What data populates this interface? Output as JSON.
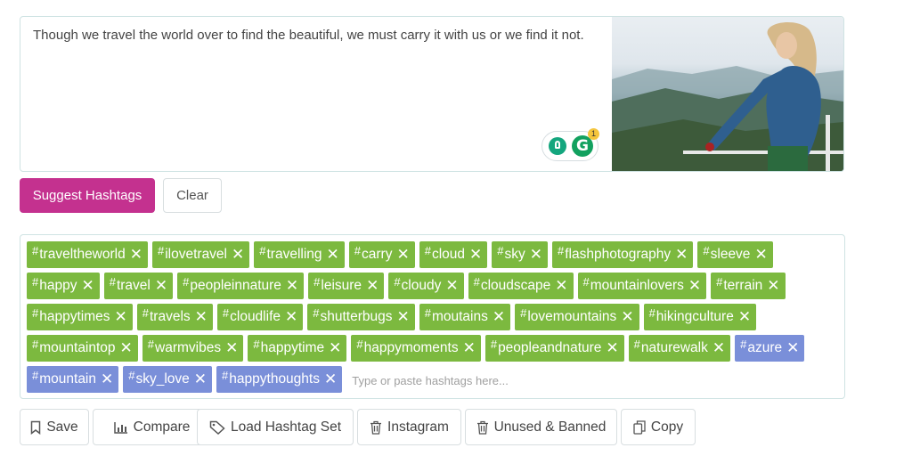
{
  "caption": {
    "text": "Though we travel the world over to find the beautiful, we must carry it with us or we find it not."
  },
  "grammarly": {
    "badge_count": "1",
    "logo_letter": "G"
  },
  "buttons": {
    "suggest": "Suggest Hashtags",
    "clear": "Clear"
  },
  "tags": [
    {
      "label": "traveltheworld",
      "color": "green"
    },
    {
      "label": "ilovetravel",
      "color": "green"
    },
    {
      "label": "travelling",
      "color": "green"
    },
    {
      "label": "carry",
      "color": "green"
    },
    {
      "label": "cloud",
      "color": "green"
    },
    {
      "label": "sky",
      "color": "green"
    },
    {
      "label": "flashphotography",
      "color": "green"
    },
    {
      "label": "sleeve",
      "color": "green"
    },
    {
      "label": "happy",
      "color": "green"
    },
    {
      "label": "travel",
      "color": "green"
    },
    {
      "label": "peopleinnature",
      "color": "green"
    },
    {
      "label": "leisure",
      "color": "green"
    },
    {
      "label": "cloudy",
      "color": "green"
    },
    {
      "label": "cloudscape",
      "color": "green"
    },
    {
      "label": "mountainlovers",
      "color": "green"
    },
    {
      "label": "terrain",
      "color": "green"
    },
    {
      "label": "happytimes",
      "color": "green"
    },
    {
      "label": "travels",
      "color": "green"
    },
    {
      "label": "cloudlife",
      "color": "green"
    },
    {
      "label": "shutterbugs",
      "color": "green"
    },
    {
      "label": "moutains",
      "color": "green"
    },
    {
      "label": "lovemountains",
      "color": "green"
    },
    {
      "label": "hikingculture",
      "color": "green"
    },
    {
      "label": "mountaintop",
      "color": "green"
    },
    {
      "label": "warmvibes",
      "color": "green"
    },
    {
      "label": "happytime",
      "color": "green"
    },
    {
      "label": "happymoments",
      "color": "green"
    },
    {
      "label": "peopleandnature",
      "color": "green"
    },
    {
      "label": "naturewalk",
      "color": "green"
    },
    {
      "label": "azure",
      "color": "blue"
    },
    {
      "label": "mountain",
      "color": "blue"
    },
    {
      "label": "sky_love",
      "color": "blue"
    },
    {
      "label": "happythoughts",
      "color": "blue"
    }
  ],
  "tag_input": {
    "placeholder": "Type or paste hashtags here..."
  },
  "tag_colors": {
    "green": "#7cb93f",
    "blue": "#7a8fd9"
  },
  "actions": {
    "save": "Save",
    "compare": "Compare",
    "load_set": "Load Hashtag Set",
    "instagram": "Instagram",
    "unused_banned": "Unused & Banned",
    "copy": "Copy"
  },
  "accent_color": "#c4318f"
}
